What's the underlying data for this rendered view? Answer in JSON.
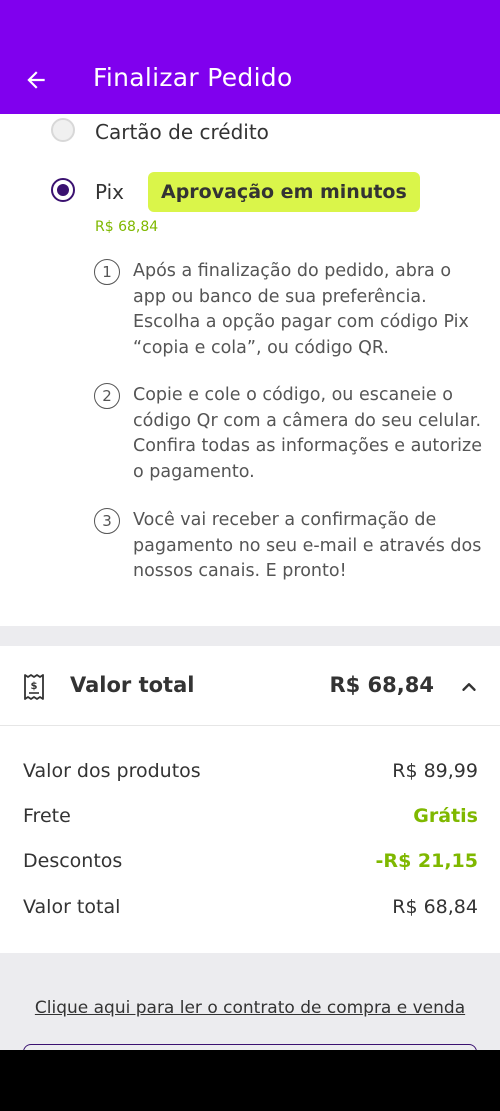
{
  "header": {
    "title": "Finalizar Pedido",
    "back_icon": "arrow-left-icon",
    "background": "#8000ee"
  },
  "payment": {
    "credit_card_label": "Cartão de crédito",
    "pix_label": "Pix",
    "pix_badge": "Aprovação em minutos",
    "pix_price": "R$ 68,84",
    "selected": "Pix",
    "steps": [
      {
        "number": "1",
        "text": "Após a finalização do pedido, abra o app ou banco de sua preferência. Escolha a opção pagar com código Pix “copia e cola”, ou código QR."
      },
      {
        "number": "2",
        "text": "Copie e cole o código, ou escaneie o código Qr com a câmera do seu celular. Confira todas as informações e autorize o pagamento."
      },
      {
        "number": "3",
        "text": "Você vai receber a confirmação de pagamento no seu e-mail e através dos nossos canais. E pronto!"
      }
    ]
  },
  "summary": {
    "title": "Valor total",
    "total": "R$ 68,84",
    "receipt_icon": "receipt-icon",
    "chevron_icon": "chevron-up-icon",
    "lines": [
      {
        "label": "Valor dos produtos",
        "value": "R$ 89,99"
      },
      {
        "label": "Frete",
        "value": "Grátis"
      },
      {
        "label": "Descontos",
        "value": "-R$ 21,15"
      },
      {
        "label": "Valor total",
        "value": "R$ 68,84"
      }
    ]
  },
  "contract_link": "Clique aqui para ler o contrato de compra e venda",
  "colors": {
    "primary": "#8000ee",
    "accent_green": "#7fb800",
    "badge": "#daf54a",
    "radio_selected": "#3a1170"
  }
}
